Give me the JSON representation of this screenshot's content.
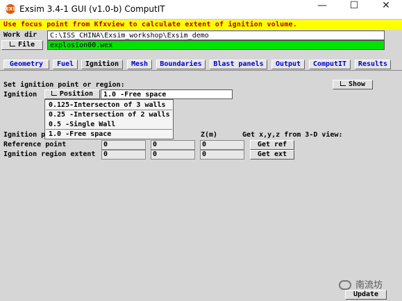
{
  "window": {
    "title": "Exsim 3.4-1 GUI (v1.0-b) ComputIT",
    "icon_text": "EXSIM",
    "icon": "exsim-app-icon"
  },
  "controls": {
    "minimize": "—",
    "maximize": "☐",
    "close": "✕"
  },
  "hint": "Use focus point from Kfxview to calculate extent of ignition volume.",
  "workdir": {
    "label": "Work dir",
    "value": "C:\\ISS_CHINA\\Exsim_workshop\\Exsim_demo"
  },
  "file": {
    "button": "File",
    "value": "explosion00.wex"
  },
  "tabs": [
    "Geometry",
    "Fuel",
    "Ignition",
    "Mesh",
    "Boundaries",
    "Blast panels",
    "Output",
    "ComputIT",
    "Results"
  ],
  "active_tab": "Ignition",
  "ignition": {
    "section_label": "Set ignition point or region:",
    "show_button": "Show",
    "row_label": "Ignition",
    "position_button": "Position",
    "selected_value": "1.0  -Free space",
    "options": [
      "0.125-Intersecton of 3 walls",
      "0.25 -Intersection of 2 walls",
      "0.5  -Single Wall",
      "1.0  -Free space"
    ],
    "partial_label": "Ignition p",
    "z_header": "Z(m)",
    "get_xyz_label": "Get x,y,z from 3-D view:",
    "rows": [
      {
        "label": "Reference point",
        "x": "0",
        "y": "0",
        "z": "0",
        "button": "Get ref"
      },
      {
        "label": "Ignition region extent",
        "x": "0",
        "y": "0",
        "z": "0",
        "button": "Get ext"
      }
    ]
  },
  "update_button": "Update",
  "watermark": "南流坊"
}
